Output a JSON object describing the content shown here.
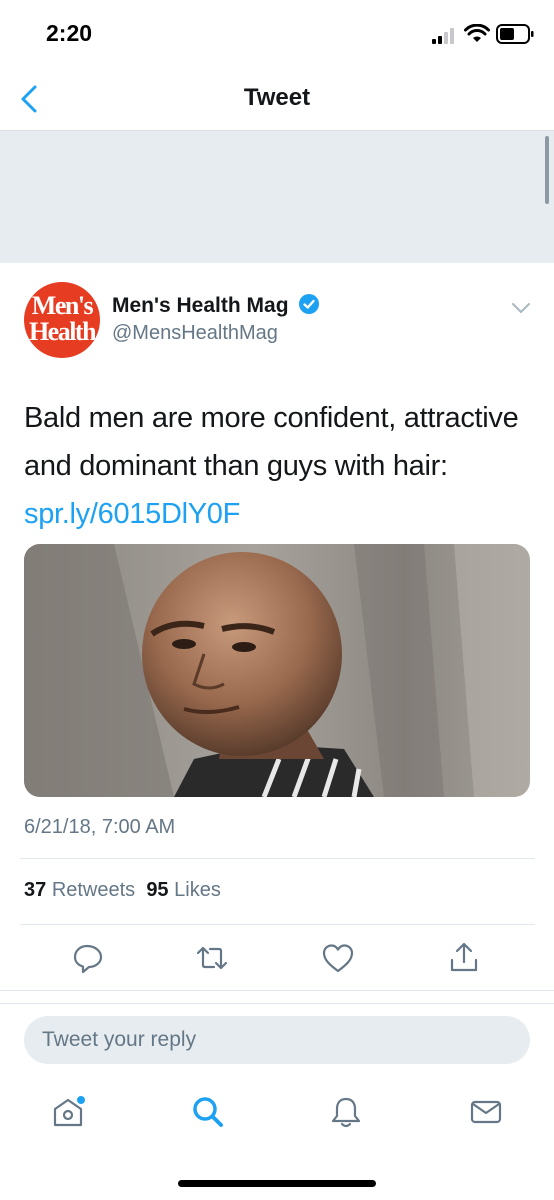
{
  "status_bar": {
    "time": "2:20"
  },
  "nav": {
    "title": "Tweet",
    "back_icon": "chevron-left-icon"
  },
  "tweet": {
    "avatar_text_line1": "Men's",
    "avatar_text_line2": "Health",
    "display_name": "Men's Health Mag",
    "verified": true,
    "handle": "@MensHealthMag",
    "text": "Bald men are more confident, attractive and dominant than guys with hair: ",
    "link": "spr.ly/6015DlY0F",
    "timestamp": "6/21/18, 7:00 AM",
    "retweets_count": "37",
    "retweets_label": "Retweets",
    "likes_count": "95",
    "likes_label": "Likes"
  },
  "actions": [
    "reply-icon",
    "retweet-icon",
    "like-icon",
    "share-icon"
  ],
  "reply": {
    "placeholder": "Tweet your reply"
  },
  "tab_bar": [
    "home-icon",
    "search-icon",
    "notifications-icon",
    "messages-icon"
  ],
  "colors": {
    "accent": "#1da1f2",
    "muted": "#657786",
    "banner": "#e6ecf0",
    "avatar": "#e63d22"
  }
}
